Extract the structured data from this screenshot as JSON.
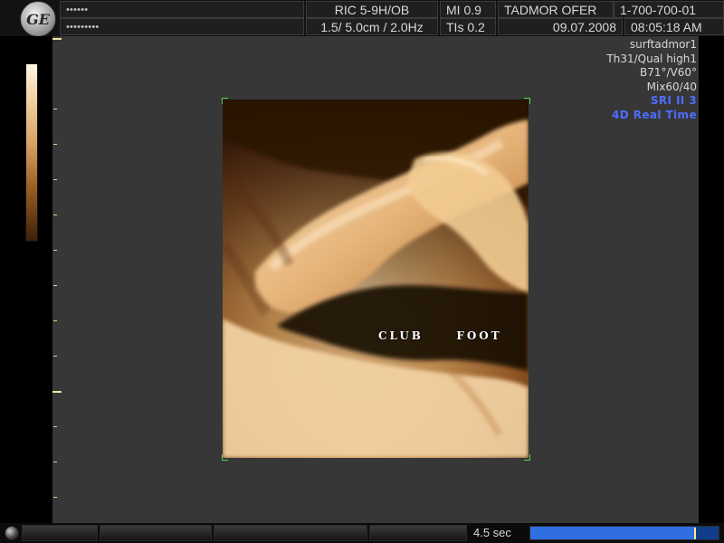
{
  "header": {
    "logo_text": "GE",
    "patient_id_masked": "••••••",
    "patient_name_masked": "•••••••••",
    "probe": "RIC 5-9H/OB",
    "depth_freq": "1.5/ 5.0cm / 2.0Hz",
    "mi": "MI  0.9",
    "tis": "TIs  0.2",
    "operator": "TADMOR  OFER",
    "phone": "1-700-700-01",
    "date": "09.07.2008",
    "time": "08:05:18 AM"
  },
  "parameters": [
    {
      "text": "surftadmor1",
      "color": "#d7d7d7"
    },
    {
      "text": "Th31/Qual high1",
      "color": "#d7d7d7"
    },
    {
      "text": "B71°/V60°",
      "color": "#d7d7d7"
    },
    {
      "text": "Mix60/40",
      "color": "#d7d7d7"
    },
    {
      "text": "SRI II 3",
      "color": "#4f6cff"
    },
    {
      "text": "4D Real Time",
      "color": "#4f6cff"
    }
  ],
  "annotation": {
    "word1": "CLUB",
    "word2": "FOOT"
  },
  "cine": {
    "time_readout": "4.5 sec",
    "progress_fraction": 0.88
  },
  "colors": {
    "background": "#373737",
    "accent_blue": "#4f6cff",
    "progress_blue": "#2f6fe2",
    "marker_yellow": "#ffe88a"
  }
}
